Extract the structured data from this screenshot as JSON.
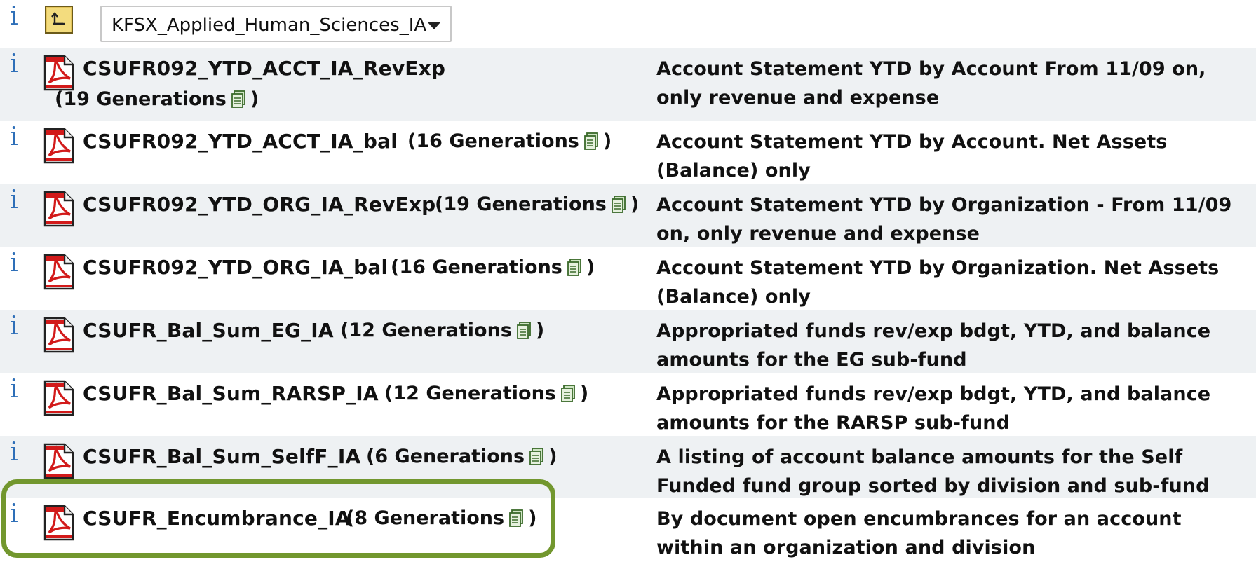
{
  "toolbar": {
    "folder_dropdown": {
      "selected": "KFSX_Applied_Human_Sciences_IA"
    }
  },
  "info_glyph": "i",
  "reports": [
    {
      "name": "CSUFR092_YTD_ACCT_IA_RevExp",
      "generations": "(19 Generations",
      "generations_close": ")",
      "description": "Account Statement YTD by Account From 11/09 on, only revenue and expense"
    },
    {
      "name": "CSUFR092_YTD_ACCT_IA_bal",
      "generations": "(16 Generations",
      "generations_close": ")",
      "description": "Account Statement YTD by Account. Net Assets (Balance) only"
    },
    {
      "name": "CSUFR092_YTD_ORG_IA_RevExp",
      "generations": "(19 Generations",
      "generations_close": ")",
      "description": "Account Statement YTD by Organization - From 11/09 on, only revenue and expense"
    },
    {
      "name": "CSUFR092_YTD_ORG_IA_bal",
      "generations": "(16 Generations",
      "generations_close": ")",
      "description": "Account Statement YTD by Organization. Net Assets (Balance) only"
    },
    {
      "name": "CSUFR_Bal_Sum_EG_IA",
      "generations": "(12 Generations",
      "generations_close": ")",
      "description": "Appropriated funds rev/exp bdgt, YTD, and balance amounts for the EG sub-fund"
    },
    {
      "name": "CSUFR_Bal_Sum_RARSP_IA",
      "generations": "(12 Generations",
      "generations_close": ")",
      "description": "Appropriated funds rev/exp bdgt, YTD, and balance amounts for the RARSP sub-fund"
    },
    {
      "name": "CSUFR_Bal_Sum_SelfF_IA",
      "generations": "(6 Generations",
      "generations_close": ")",
      "description": "A listing of account balance amounts for the Self Funded fund group sorted by division and sub-fund"
    },
    {
      "name": "CSUFR_Encumbrance_IA",
      "generations": "(8 Generations",
      "generations_close": ")",
      "description": "By document open encumbrances for an account within an organization and division"
    }
  ],
  "colors": {
    "info_blue": "#2e6fb8",
    "row_alt": "#eef1f3",
    "gutter": "#f1f6dc",
    "highlight_green": "#72972e",
    "pdf_red": "#d21a1a"
  }
}
